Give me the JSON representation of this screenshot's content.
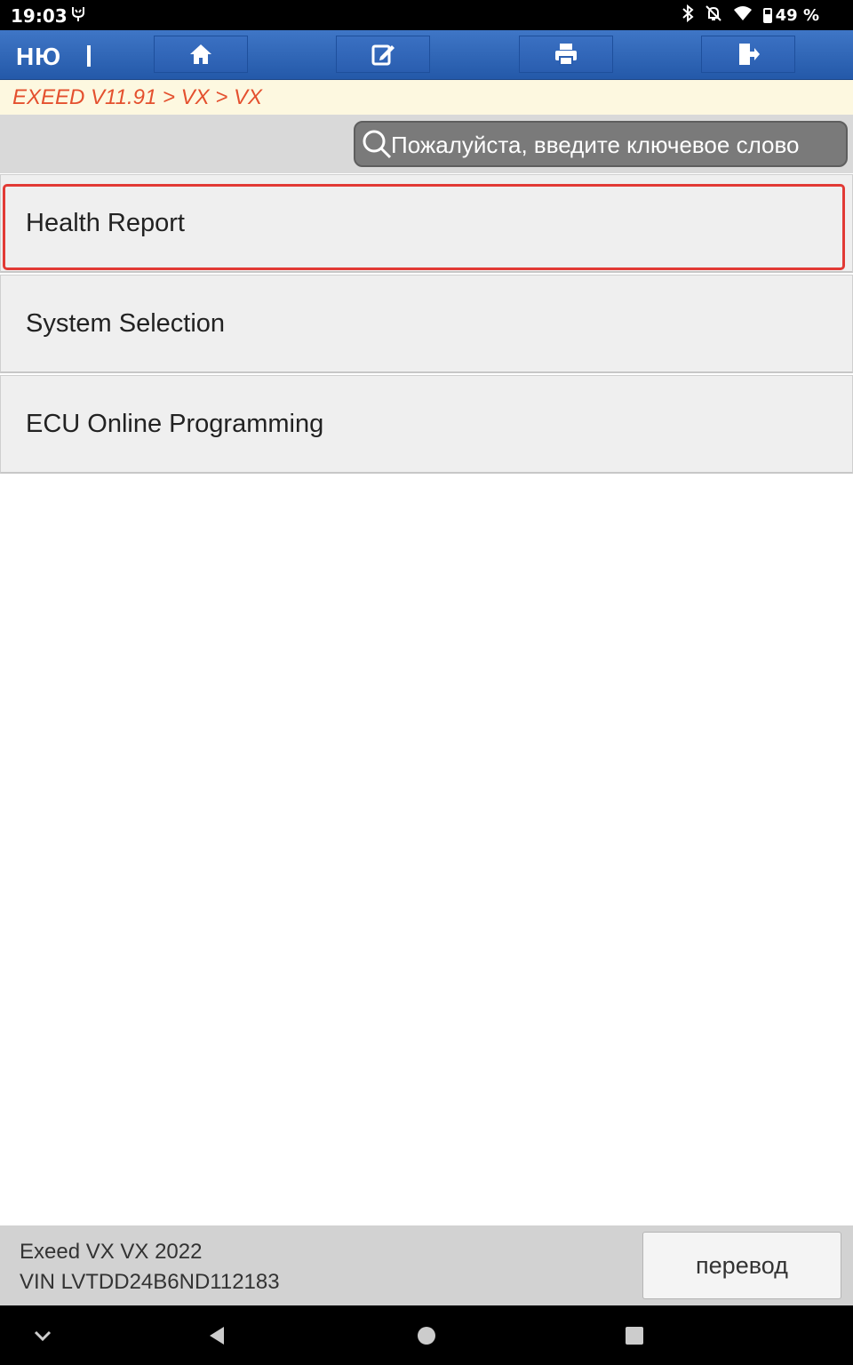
{
  "status_bar": {
    "time": "19:03",
    "battery": "49 %",
    "icons": [
      "usb-debug-icon",
      "bluetooth-icon",
      "muted-bell-icon",
      "wifi-icon",
      "battery-icon"
    ]
  },
  "toolbar": {
    "menu_label": "НЮ",
    "buttons": [
      "home-icon",
      "edit-icon",
      "print-icon",
      "exit-icon"
    ],
    "accent_color": "#2f63b4"
  },
  "breadcrumb": {
    "path": "EXEED V11.91 > VX > VX",
    "color": "#e4502e"
  },
  "search": {
    "placeholder": "Пожалуйста, введите ключевое слово",
    "value": ""
  },
  "menu": {
    "items": [
      {
        "label": "Health Report",
        "selected": true
      },
      {
        "label": "System Selection",
        "selected": false
      },
      {
        "label": "ECU Online Programming",
        "selected": false
      }
    ],
    "selection_color": "#e23a35"
  },
  "footer": {
    "vehicle": "Exeed VX VX 2022",
    "vin": "VIN LVTDD24B6ND112183",
    "translate_label": "перевод"
  },
  "nav_bar": {
    "buttons": [
      "collapse-icon",
      "back-icon",
      "home-circle-icon",
      "recents-icon"
    ]
  }
}
